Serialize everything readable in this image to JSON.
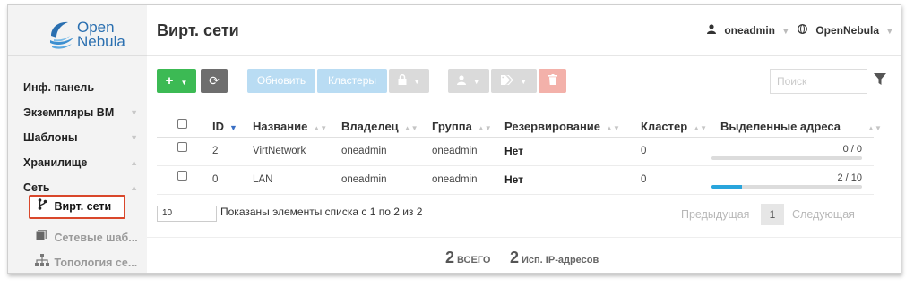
{
  "brand": {
    "line1": "Open",
    "line2": "Nebula",
    "logo_color": "#2a6fb0"
  },
  "sidebar": {
    "items": [
      {
        "label": "Инф. панель"
      },
      {
        "label": "Экземпляры ВМ"
      },
      {
        "label": "Шаблоны"
      },
      {
        "label": "Хранилище"
      },
      {
        "label": "Сеть"
      }
    ],
    "sub_items": [
      {
        "label": "Вирт. сети",
        "icon": "branch-icon",
        "active": true
      },
      {
        "label": "Сетевые шаб...",
        "icon": "stack-icon"
      },
      {
        "label": "Топология се...",
        "icon": "sitemap-icon"
      }
    ],
    "active_border_color": "#d9472b"
  },
  "header": {
    "title": "Вирт. сети",
    "user": "oneadmin",
    "zone": "OpenNebula"
  },
  "toolbar": {
    "add_label": "+",
    "update_label": "Обновить",
    "clusters_label": "Кластеры",
    "search_placeholder": "Поиск",
    "colors": {
      "add": "#3cba54",
      "refresh": "#6e6e6e",
      "info": "#b9dcf3",
      "danger": "#f3b1aa"
    }
  },
  "table": {
    "columns": [
      "ID",
      "Название",
      "Владелец",
      "Группа",
      "Резервирование",
      "Кластер",
      "Выделенные адреса"
    ],
    "rows": [
      {
        "id": "2",
        "name": "VirtNetwork",
        "owner": "oneadmin",
        "group": "oneadmin",
        "reservation": "Нет",
        "cluster": "0",
        "usage": "0 / 0",
        "usage_fraction": 0
      },
      {
        "id": "0",
        "name": "LAN",
        "owner": "oneadmin",
        "group": "oneadmin",
        "reservation": "Нет",
        "cluster": "0",
        "usage": "2 / 10",
        "usage_fraction": 0.2
      }
    ]
  },
  "pagination": {
    "page_size": "10",
    "listing": "Показаны элементы списка с 1 по 2 из 2",
    "prev": "Предыдущая",
    "current": "1",
    "next": "Следующая"
  },
  "footer": {
    "total_num": "2",
    "total_label": "ВСЕГО",
    "used_num": "2",
    "used_label": "Исп. IP-адресов"
  }
}
